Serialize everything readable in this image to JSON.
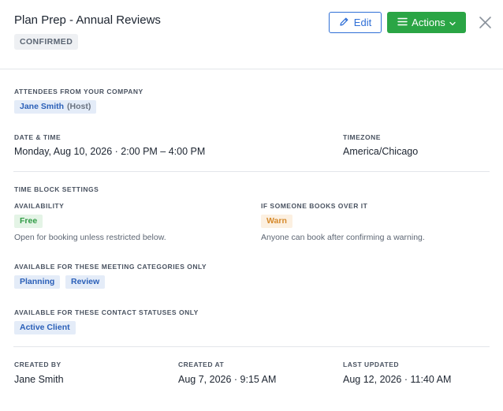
{
  "header": {
    "title": "Plan Prep - Annual Reviews",
    "status": "CONFIRMED",
    "edit_label": "Edit",
    "actions_label": "Actions",
    "accent": "#2f6fd6",
    "actions_color": "#2aa545"
  },
  "attendees": {
    "label": "ATTENDEES FROM YOUR COMPANY",
    "name": "Jane Smith",
    "role": "(Host)"
  },
  "datetime": {
    "label": "DATE & TIME",
    "value": "Monday, Aug 10, 2026 · 2:00 PM – 4:00 PM",
    "tz_label": "TIMEZONE",
    "tz_value": "America/Chicago"
  },
  "time_block": {
    "label": "TIME BLOCK SETTINGS",
    "availability_label": "AVAILABILITY",
    "availability_value": "Free",
    "availability_help": "Open for booking unless restricted below.",
    "overbook_label": "IF SOMEONE BOOKS OVER IT",
    "overbook_value": "Warn",
    "overbook_help": "Anyone can book after confirming a warning.",
    "categories_label": "AVAILABLE FOR THESE MEETING CATEGORIES ONLY",
    "categories": [
      "Planning",
      "Review"
    ],
    "statuses_label": "AVAILABLE FOR THESE CONTACT STATUSES ONLY",
    "statuses": [
      "Active Client"
    ]
  },
  "meta": {
    "created_by_label": "CREATED BY",
    "created_by": "Jane Smith",
    "created_at_label": "CREATED AT",
    "created_at": "Aug 7, 2026 · 9:15 AM",
    "updated_label": "LAST UPDATED",
    "updated": "Aug 12, 2026 · 11:40 AM"
  },
  "icons": {
    "edit": "pencil-icon",
    "actions": "menu-icon",
    "actions_caret": "chevron-down-icon",
    "close": "close-icon"
  }
}
